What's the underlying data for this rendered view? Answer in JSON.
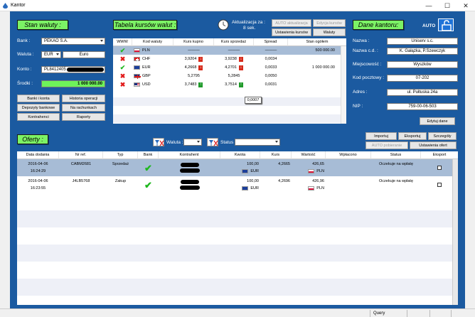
{
  "window": {
    "title": "Kantor",
    "minimize": "—",
    "maximize": "☐",
    "close": "✕"
  },
  "left_panel": {
    "heading": "Stan waluty :",
    "bank_label": "Bank :",
    "bank_value": "PEKAO S.A.",
    "currency_label": "Waluta :",
    "currency_value": "EUR",
    "currency_name": "Euro",
    "account_label": "Konto :",
    "account_value": "PL8412405",
    "funds_label": "Środki :",
    "funds_value": "1 000 000.00",
    "buttons": {
      "banks": "Banki i konta",
      "history": "Historia operacji",
      "deposits": "Depozyty bankowe",
      "on_accounts": "Na rachunkach",
      "contractors": "Kontrahenci",
      "reports": "Raporty"
    }
  },
  "rates_panel": {
    "heading": "Tabela kursów walut :",
    "update_label": "Aktualizacja za :",
    "update_value": "8 sek.",
    "buttons": {
      "auto_update": "AUTO aktualizacja",
      "edit_rates": "Edycja kursów",
      "rate_settings": "Ustawienia kursów",
      "currencies": "Waluty"
    },
    "columns": [
      "WWW",
      "Kod waluty",
      "Kurs kupno",
      "Kurs sprzedaż",
      "Spread",
      "Stan ogółem"
    ],
    "rows": [
      {
        "status": "check",
        "code": "PLN",
        "buy": "———",
        "sell": "———",
        "spread": "———",
        "total": "500 000.00",
        "buy_trend": "",
        "sell_trend": ""
      },
      {
        "status": "x",
        "code": "CHF",
        "buy": "3,9204",
        "sell": "3,9238",
        "spread": "0,0034",
        "total": "",
        "buy_trend": "down",
        "sell_trend": "down"
      },
      {
        "status": "check",
        "code": "EUR",
        "buy": "4,2668",
        "sell": "4,2701",
        "spread": "0,0033",
        "total": "1 000 000.00",
        "buy_trend": "down",
        "sell_trend": "down"
      },
      {
        "status": "x",
        "code": "GBP",
        "buy": "5,2795",
        "sell": "5,2845",
        "spread": "0,0050",
        "total": "",
        "buy_trend": "",
        "sell_trend": ""
      },
      {
        "status": "x",
        "code": "USD",
        "buy": "3,7483",
        "sell": "3,7514",
        "spread": "0,0031",
        "total": "",
        "buy_trend": "up",
        "sell_trend": "up"
      }
    ],
    "tooltip": "0,0007"
  },
  "office_panel": {
    "heading": "Dane kantoru:",
    "auto_label": "AUTO",
    "name_label": "Nazwa :",
    "name_value": "Uniserv s.c.",
    "fullname_label": "Nazwa c.d. :",
    "fullname_value": "K. Gałązka, P.Szewczyk",
    "city_label": "Miejscowość :",
    "city_value": "Wyszków",
    "postal_label": "Kod pocztowy :",
    "postal_value": "07-202",
    "address_label": "Adres :",
    "address_value": "ul. Pułtuska 24a",
    "nip_label": "NIP :",
    "nip_value": "759-00-06-503",
    "edit_button": "Edytuj dane"
  },
  "offers": {
    "heading": "Oferty :",
    "currency_filter_label": "Waluta :",
    "status_filter_label": "Status",
    "buttons": {
      "import": "Importuj",
      "export": "Eksportuj",
      "details": "Szczegóły",
      "auto_fetch": "AUTO pobieranie",
      "offer_settings": "Ustawienia ofert"
    },
    "columns": [
      "Data dodania",
      "Nr ref.",
      "Typ",
      "Bank",
      "Kontrahent",
      "Kwota",
      "Kurs",
      "Wartość",
      "Wpłacono",
      "Status",
      "Eksport"
    ],
    "rows": [
      {
        "date": "2016-04-06",
        "time": "16:24:29",
        "ref": "CABM2681",
        "type": "Sprzedaż",
        "amount": "100,00",
        "amount_cur": "EUR",
        "rate": "4,2665",
        "value": "426,65",
        "value_cur": "PLN",
        "paid": "",
        "status": "Oczekuje na wpłatę"
      },
      {
        "date": "2016-04-06",
        "time": "16:23:55",
        "ref": "J4LB5768",
        "type": "Zakup",
        "amount": "100,00",
        "amount_cur": "EUR",
        "rate": "4,2696",
        "value": "426,96",
        "value_cur": "PLN",
        "paid": "",
        "status": "Oczekuje na wpłatę"
      }
    ]
  },
  "statusbar": {
    "query": "Query"
  },
  "colors": {
    "background": "#1b5aa0",
    "heading": "#7cf265",
    "selected_row": "#a7bcd6"
  }
}
